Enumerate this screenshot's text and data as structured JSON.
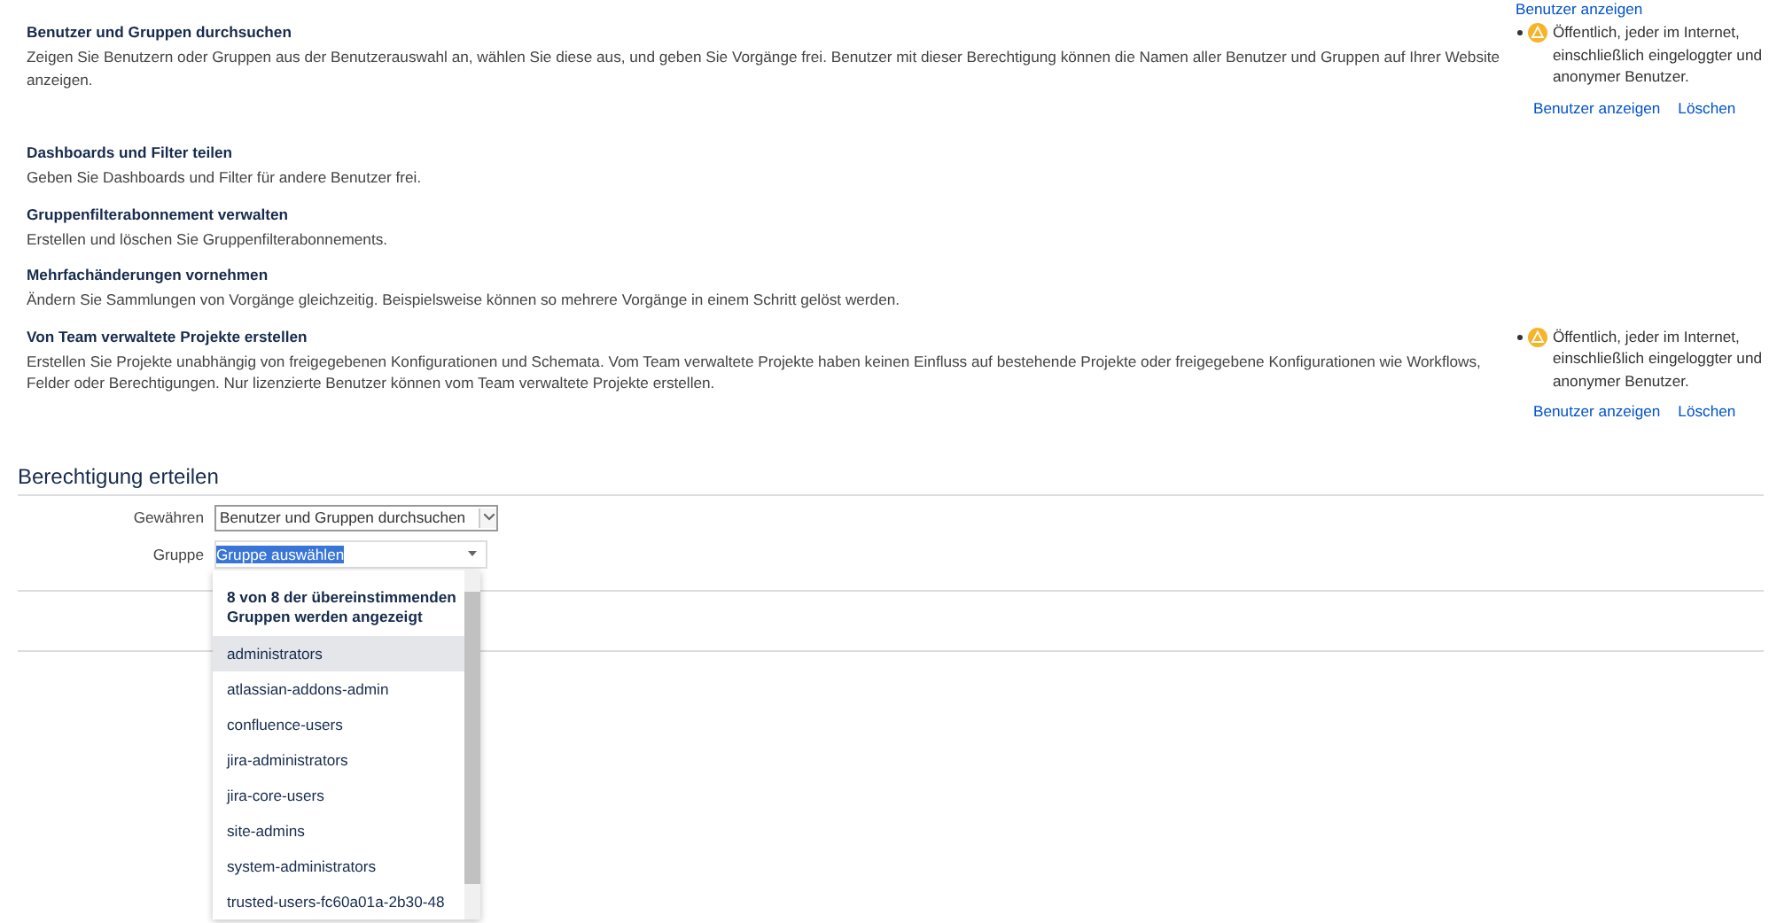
{
  "top_cut_link": "Benutzer anzeigen",
  "permissions": [
    {
      "title": "Benutzer und Gruppen durchsuchen",
      "description": "Zeigen Sie Benutzern oder Gruppen aus der Benutzerauswahl an, wählen Sie diese aus, und geben Sie Vorgänge frei. Benutzer mit dieser Berechtigung können die Namen aller Benutzer und Gruppen auf Ihrer Website anzeigen.",
      "grants": [
        {
          "text": "Öffentlich, jeder im Internet, einschließlich eingeloggter und anonymer Benutzer.",
          "links": [
            "Benutzer anzeigen",
            "Löschen"
          ]
        }
      ]
    },
    {
      "title": "Dashboards und Filter teilen",
      "description": "Geben Sie Dashboards und Filter für andere Benutzer frei."
    },
    {
      "title": "Gruppenfilterabonnement verwalten",
      "description": "Erstellen und löschen Sie Gruppenfilterabonnements."
    },
    {
      "title": "Mehrfachänderungen vornehmen",
      "description": "Ändern Sie Sammlungen von Vorgänge gleichzeitig. Beispielsweise können so mehrere Vorgänge in einem Schritt gelöst werden."
    },
    {
      "title": "Von Team verwaltete Projekte erstellen",
      "description": "Erstellen Sie Projekte unabhängig von freigegebenen Konfigurationen und Schemata. Vom Team verwaltete Projekte haben keinen Einfluss auf bestehende Projekte oder freigegebene Konfigurationen wie Workflows, Felder oder Berechtigungen. Nur lizenzierte Benutzer können vom Team verwaltete Projekte erstellen.",
      "grants": [
        {
          "text": "Öffentlich, jeder im Internet, einschließlich eingeloggter und anonymer Benutzer.",
          "links": [
            "Benutzer anzeigen",
            "Löschen"
          ]
        }
      ]
    }
  ],
  "grant_form": {
    "heading": "Berechtigung erteilen",
    "fields": [
      {
        "kind": "select",
        "label": "Gewähren",
        "value": "Benutzer und Gruppen durchsuchen"
      },
      {
        "kind": "combo",
        "label": "Gruppe",
        "placeholder": "Gruppe auswählen"
      }
    ],
    "dropdown": {
      "header": "8 von 8 der übereinstimmenden Gruppen werden angezeigt",
      "items": [
        {
          "label": "administrators",
          "selected": true
        },
        {
          "label": "atlassian-addons-admin",
          "selected": false
        },
        {
          "label": "confluence-users",
          "selected": false
        },
        {
          "label": "jira-administrators",
          "selected": false
        },
        {
          "label": "jira-core-users",
          "selected": false
        },
        {
          "label": "site-admins",
          "selected": false
        },
        {
          "label": "system-administrators",
          "selected": false
        },
        {
          "label": "trusted-users-fc60a01a-2b30-48",
          "selected": false
        }
      ]
    }
  }
}
